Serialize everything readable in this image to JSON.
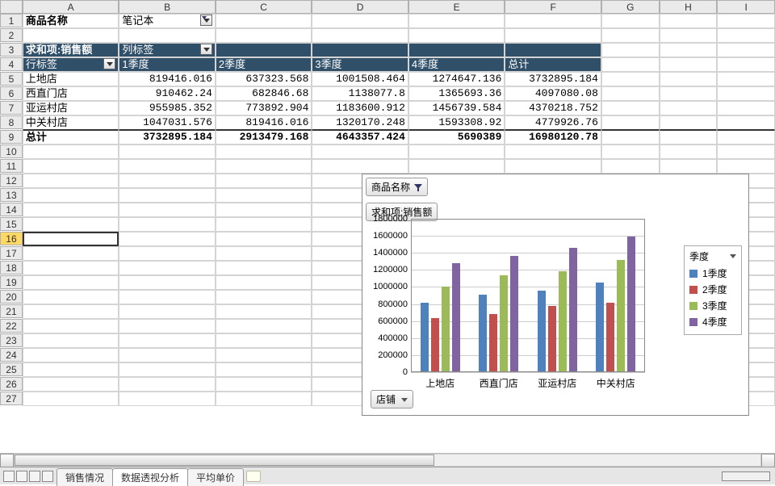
{
  "columns": [
    "A",
    "B",
    "C",
    "D",
    "E",
    "F",
    "G",
    "H",
    "I"
  ],
  "rows_label_count": 27,
  "selected_row": 16,
  "A1": "商品名称",
  "B1": "笔记本",
  "A3": "求和项:销售额",
  "B3": "列标签",
  "A4": "行标签",
  "pivot_cols": [
    "1季度",
    "2季度",
    "3季度",
    "4季度",
    "总计"
  ],
  "pivot_rows": [
    {
      "label": "上地店",
      "v": [
        "819416.016",
        "637323.568",
        "1001508.464",
        "1274647.136",
        "3732895.184"
      ]
    },
    {
      "label": "西直门店",
      "v": [
        "910462.24",
        "682846.68",
        "1138077.8",
        "1365693.36",
        "4097080.08"
      ]
    },
    {
      "label": "亚运村店",
      "v": [
        "955985.352",
        "773892.904",
        "1183600.912",
        "1456739.584",
        "4370218.752"
      ]
    },
    {
      "label": "中关村店",
      "v": [
        "1047031.576",
        "819416.016",
        "1320170.248",
        "1593308.92",
        "4779926.76"
      ]
    }
  ],
  "totals": {
    "label": "总计",
    "v": [
      "3732895.184",
      "2913479.168",
      "4643357.424",
      "5690389",
      "16980120.78"
    ]
  },
  "chart_title_btn": "商品名称",
  "chart_value_btn": "求和项:销售额",
  "legend_title": "季度",
  "legend_items": [
    "1季度",
    "2季度",
    "3季度",
    "4季度"
  ],
  "x_axis_btn": "店铺",
  "sheet_tabs": [
    "销售情况",
    "数据透视分析",
    "平均单价"
  ],
  "chart_data": {
    "type": "bar",
    "title": "",
    "categories": [
      "上地店",
      "西直门店",
      "亚运村店",
      "中关村店"
    ],
    "series": [
      {
        "name": "1季度",
        "values": [
          819416,
          910462,
          955985,
          1047032
        ]
      },
      {
        "name": "2季度",
        "values": [
          637324,
          682847,
          773893,
          819416
        ]
      },
      {
        "name": "3季度",
        "values": [
          1001508,
          1138078,
          1183601,
          1320170
        ]
      },
      {
        "name": "4季度",
        "values": [
          1274647,
          1365693,
          1456740,
          1593309
        ]
      }
    ],
    "ylim": [
      0,
      1800000
    ],
    "ytick": 200000,
    "xlabel": "店铺",
    "ylabel": "",
    "legend_title": "季度"
  }
}
